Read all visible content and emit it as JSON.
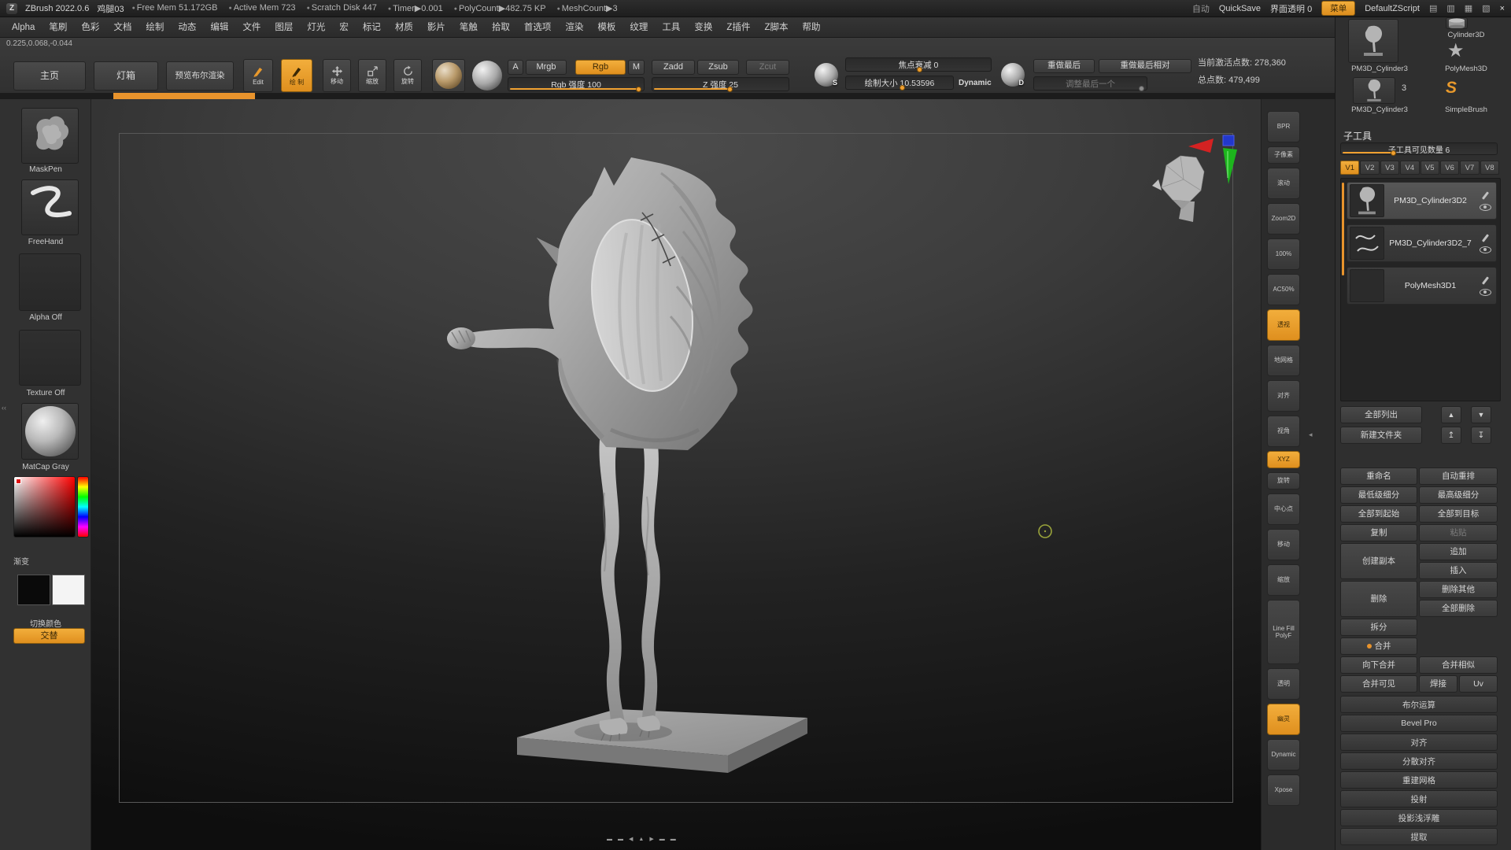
{
  "colors": {
    "accent": "#e8992c",
    "canvas_top": "#4b4b4b",
    "canvas_bottom": "#0e0e0e"
  },
  "icons": {
    "logo": "Z",
    "close": "×",
    "panel_a": "▤",
    "panel_b": "▥",
    "panel_c": "▦",
    "panel_d": "▧",
    "up": "▲",
    "down": "▼",
    "folder_up": "↥",
    "folder_down": "↧",
    "left": "◀",
    "right": "▶",
    "dash": "▬",
    "collapse": "‹‹",
    "small_left": "◂",
    "star": "★"
  },
  "title_bar": {
    "app_name": "ZBrush 2022.0.6",
    "doc_name": "鸡腿03",
    "stats": [
      "Free Mem 51.172GB",
      "Active Mem 723",
      "Scratch Disk 447",
      "Timer▶0.001",
      "PolyCount▶482.75 KP",
      "MeshCount▶3"
    ],
    "auto": "自动",
    "quicksave": "QuickSave",
    "ui_transparency": "界面透明 0",
    "menu": "菜单",
    "zscript": "DefaultZScript"
  },
  "menu_bar": {
    "items": [
      "Alpha",
      "笔刷",
      "色彩",
      "文档",
      "绘制",
      "动态",
      "编辑",
      "文件",
      "图层",
      "灯光",
      "宏",
      "标记",
      "材质",
      "影片",
      "笔触",
      "拾取",
      "首选项",
      "渲染",
      "模板",
      "纹理",
      "工具",
      "变换",
      "Z插件",
      "Z脚本",
      "帮助"
    ]
  },
  "shelf": {
    "coords": "0.225,0.068,-0.044",
    "home": "主页",
    "lightbox": "灯箱",
    "preview_boolean": "预览布尔渲染",
    "edit": "Edit",
    "draw": "绘 制",
    "move": "移动",
    "scale": "缩放",
    "rotate": "旋转",
    "mode_a": "A",
    "mode_mrgb": "Mrgb",
    "mode_rgb": "Rgb",
    "mode_m": "M",
    "zadd": "Zadd",
    "zsub": "Zsub",
    "zcut": "Zcut",
    "rgb_intensity": "Rgb 强度 100",
    "z_intensity": "Z 强度 25",
    "focal_shift": "焦点衰减 0",
    "draw_size": "绘制大小 10.53596",
    "dynamic": "Dynamic",
    "s_label": "S",
    "d_label": "D",
    "redo_last": "重做最后",
    "redo_last_relative": "重做最后相对",
    "adjust_last": "调整最后一个",
    "active_points": "当前激活点数: 278,360",
    "total_points": "总点数: 479,499"
  },
  "left_panel": {
    "brush": "MaskPen",
    "stroke": "FreeHand",
    "alpha": "Alpha Off",
    "texture": "Texture Off",
    "material": "MatCap Gray",
    "gradient": "渐变",
    "switch_colors": "切换颜色",
    "swap": "交替"
  },
  "right_strip": {
    "items": [
      {
        "label": "BPR",
        "h": "md"
      },
      {
        "label": "子像素",
        "h": "sm"
      },
      {
        "label": "滚动",
        "h": "md"
      },
      {
        "label": "Zoom2D",
        "h": "md"
      },
      {
        "label": "100%",
        "h": "md"
      },
      {
        "label": "AC50%",
        "h": "md"
      },
      {
        "label": "透视",
        "h": "md",
        "active": true
      },
      {
        "label": "地网格",
        "h": "md"
      },
      {
        "label": "对齐",
        "h": "md"
      },
      {
        "label": "视角",
        "h": "md"
      },
      {
        "label": "XYZ",
        "h": "sm",
        "active": true
      },
      {
        "label": "旋转",
        "h": "sm"
      },
      {
        "label": "中心点",
        "h": "md"
      },
      {
        "label": "移动",
        "h": "md"
      },
      {
        "label": "缩放",
        "h": "md"
      },
      {
        "label": "Line Fill PolyF",
        "h": "tall"
      },
      {
        "label": "透明",
        "h": "md"
      },
      {
        "label": "幽灵",
        "h": "md",
        "active": true
      },
      {
        "label": "Dynamic",
        "h": "md"
      },
      {
        "label": "Xpose",
        "h": "md"
      }
    ]
  },
  "tool_panel": {
    "big_label": "PM3D_Cylinder3",
    "cylinder_label": "Cylinder3D",
    "polymesh_label": "PolyMesh3D",
    "second_label": "PM3D_Cylinder3",
    "second_badge": "3",
    "simplebrush_label": "SimpleBrush",
    "simplebrush_glyph": "S"
  },
  "subtool": {
    "title": "子工具",
    "visible_count": "子工具可见数量 6",
    "tabs": [
      {
        "label": "V1",
        "active": true
      },
      {
        "label": "V2"
      },
      {
        "label": "V3"
      },
      {
        "label": "V4"
      },
      {
        "label": "V5"
      },
      {
        "label": "V6"
      },
      {
        "label": "V7"
      },
      {
        "label": "V8"
      }
    ],
    "items": [
      {
        "name": "PM3D_Cylinder3D2",
        "selected": true,
        "thumb": "leg"
      },
      {
        "name": "PM3D_Cylinder3D2_7",
        "thumb": "scribble"
      },
      {
        "name": "PolyMesh3D1",
        "thumb": "none"
      }
    ],
    "buttons": {
      "list_all": "全部列出",
      "new_folder": "新建文件夹",
      "rename": "重命名",
      "auto_reorder": "自动重排",
      "lowest_subdiv": "最低级细分",
      "highest_subdiv": "最高级细分",
      "all_to_start": "全部到起始",
      "all_to_target": "全部到目标",
      "copy": "复制",
      "paste": "粘贴",
      "duplicate": "创建副本",
      "append": "追加",
      "insert": "插入",
      "delete": "删除",
      "delete_other": "删除其他",
      "delete_all": "全部删除",
      "split": "拆分",
      "merge": "合并",
      "merge_down": "向下合并",
      "merge_similar": "合并相似",
      "merge_visible": "合并可见",
      "weld": "焊接",
      "uv": "Uv"
    },
    "sections": [
      "布尔运算",
      "Bevel Pro",
      "对齐",
      "分散对齐",
      "重建网格",
      "投射",
      "投影浅浮雕",
      "提取"
    ]
  }
}
